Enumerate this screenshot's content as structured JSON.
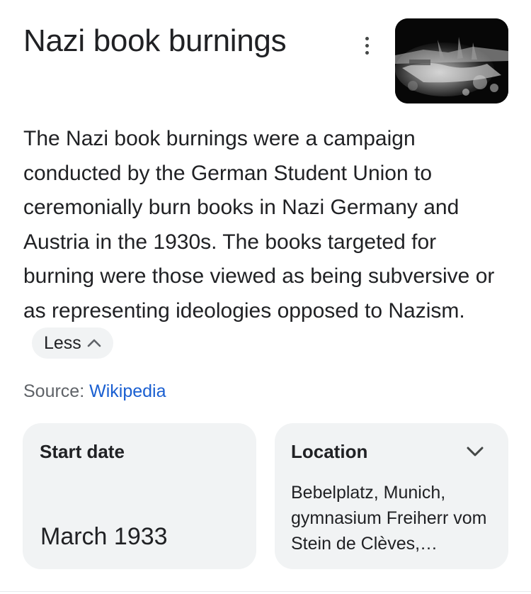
{
  "panel": {
    "title": "Nazi book burnings",
    "more_icon": "more-vert-icon",
    "description": "The Nazi book burnings were a campaign conducted by the German Student Union to ceremonially burn books in Nazi Germany and Austria in the 1930s. The books targeted for burning were those viewed as being subversive or as representing ideologies opposed to Nazism.",
    "less_label": "Less",
    "less_icon": "chevron-up-icon"
  },
  "source": {
    "prefix": "Source: ",
    "link_text": "Wikipedia",
    "link_color": "#1a5fd1"
  },
  "facts": {
    "start": {
      "label": "Start date",
      "value": "March 1933"
    },
    "location": {
      "label": "Location",
      "value": "Bebelplatz, Munich, gymnasium Freiherr vom Stein de Clèves,…",
      "expand_icon": "chevron-down-icon"
    }
  },
  "colors": {
    "card_background": "#f1f3f4",
    "text": "#202124",
    "secondary_text": "#5f6368"
  }
}
